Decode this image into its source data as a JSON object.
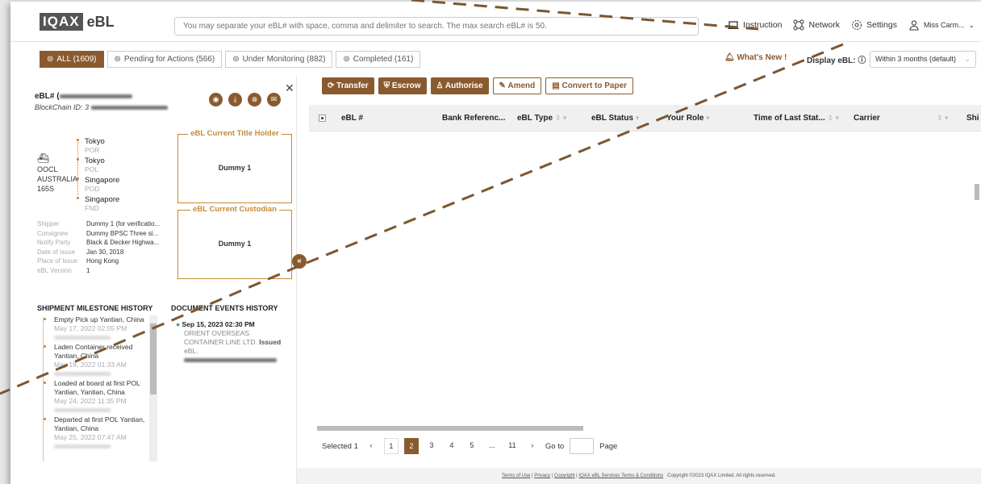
{
  "header": {
    "logo_mark": "IQAX",
    "logo_text": "eBL",
    "search_placeholder": "You may separate your eBL# with space, comma and delimiter to search. The max search eBL# is 50.",
    "nav": {
      "instruction": "Instruction",
      "network": "Network",
      "settings": "Settings",
      "user": "Miss Carm..."
    }
  },
  "tabs": [
    {
      "label": "ALL (1609)"
    },
    {
      "label": "Pending for Actions (566)"
    },
    {
      "label": "Under Monitoring (882)"
    },
    {
      "label": "Completed (161)"
    }
  ],
  "whats_new": "What's New !",
  "display_label": "Display eBL:",
  "display_range": "Within 3 months (default)",
  "panel": {
    "ebl_label": "eBL# (",
    "blockchain_label": "BlockChain ID: 3",
    "vessel": {
      "line1": "OOCL",
      "line2": "AUSTRALIA",
      "line3": "165S"
    },
    "route": [
      {
        "name": "Tokyo",
        "code": "POR"
      },
      {
        "name": "Tokyo",
        "code": "POL"
      },
      {
        "name": "Singapore",
        "code": "POD"
      },
      {
        "name": "Singapore",
        "code": "FND"
      }
    ],
    "details": [
      {
        "k": "Shipper",
        "v": "Dummy 1 (for verificatio..."
      },
      {
        "k": "Consignee",
        "v": "Dummy BPSC Three si..."
      },
      {
        "k": "Notify Party",
        "v": "Black & Decker Highwa..."
      },
      {
        "k": "Date of Issue",
        "v": "Jan 30, 2018"
      },
      {
        "k": "Place of Issue",
        "v": "Hong Kong"
      },
      {
        "k": "eBL Version",
        "v": "1"
      }
    ],
    "title_holder_label": "eBL Current Title Holder",
    "title_holder_value": "Dummy 1",
    "custodian_label": "eBL Current Custodian",
    "custodian_value": "Dummy 1",
    "milestone_title": "SHIPMENT MILESTONE HISTORY",
    "events_title": "DOCUMENT EVENTS HISTORY",
    "milestones": [
      {
        "text": "Empty Pick up Yantian, China",
        "date": "May 17, 2022 02:05 PM"
      },
      {
        "text": "Laden Container received Yantian, China",
        "date": "May 19, 2022 01:33 AM"
      },
      {
        "text": "Loaded at board at first POL Yantian, Yantian, China",
        "date": "May 24, 2022 11:35 PM"
      },
      {
        "text": "Departed at first POL Yantian, Yantian, China",
        "date": "May 25, 2022 07:47 AM"
      }
    ],
    "event": {
      "date": "Sep 15, 2023 02:30 PM",
      "company": "ORIENT OVERSEAS CONTAINER LINE LTD.",
      "action": "Issued",
      "suffix": "eBL."
    }
  },
  "actions": {
    "transfer": "Transfer",
    "escrow": "Escrow",
    "authorise": "Authorise",
    "amend": "Amend",
    "convert": "Convert to Paper"
  },
  "columns": {
    "ebl": "eBL #",
    "bank": "Bank Referenc...",
    "type": "eBL Type",
    "status": "eBL Status",
    "role": "Your Role",
    "time": "Time of Last Stat...",
    "carrier": "Carrier",
    "ship": "Shi"
  },
  "pagination": {
    "selected": "Selected 1",
    "pages": [
      "1",
      "2",
      "3",
      "4",
      "5",
      "...",
      "11"
    ],
    "current": "2",
    "goto_label": "Go to",
    "page_label": "Page"
  },
  "footer": {
    "terms": "Terms of Use",
    "privacy": "Privacy",
    "copyright_link": "Copyright",
    "services": "IQAX eBL Services Terms & Conditions",
    "copyright": "Copyright ©2023 IQAX Limited. All rights reserved."
  },
  "colors": {
    "accent": "#8a5a2f",
    "gold": "#c58a37"
  }
}
